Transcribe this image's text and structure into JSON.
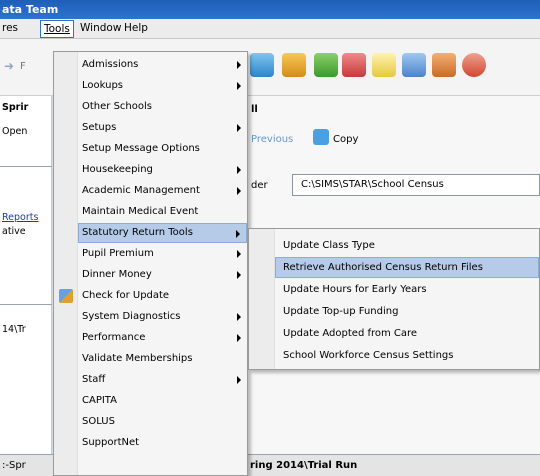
{
  "titlebar": {
    "title": "ata Team"
  },
  "menubar": {
    "items": [
      "res",
      "Tools",
      "Window",
      "Help"
    ]
  },
  "toolbar": {
    "left_fragment": "F"
  },
  "left_panel": {
    "texts": [
      "Sprir",
      "Open",
      "Reports",
      "ative",
      "14\\Tr",
      ":-Spr"
    ]
  },
  "detail": {
    "heading": "ll",
    "previous_label": "Previous",
    "copy_label": "Copy",
    "folder_label": "der",
    "folder_value": "C:\\SIMS\\STAR\\School Census",
    "status_text": "ring 2014\\Trial Run"
  },
  "tools_menu": {
    "items": [
      {
        "label": "Admissions",
        "submenu": true
      },
      {
        "label": "Lookups",
        "submenu": true
      },
      {
        "label": "Other Schools",
        "submenu": false
      },
      {
        "label": "Setups",
        "submenu": true
      },
      {
        "label": "Setup Message Options",
        "submenu": false
      },
      {
        "label": "Housekeeping",
        "submenu": true
      },
      {
        "label": "Academic Management",
        "submenu": true
      },
      {
        "label": "Maintain Medical Event",
        "submenu": false
      },
      {
        "label": "Statutory Return Tools",
        "submenu": true,
        "selected": true
      },
      {
        "label": "Pupil Premium",
        "submenu": true
      },
      {
        "label": "Dinner Money",
        "submenu": true
      },
      {
        "label": "Check for Update",
        "submenu": false
      },
      {
        "label": "System Diagnostics",
        "submenu": true
      },
      {
        "label": "Performance",
        "submenu": true
      },
      {
        "label": "Validate Memberships",
        "submenu": false
      },
      {
        "label": "Staff",
        "submenu": true
      },
      {
        "label": "CAPITA",
        "submenu": false
      },
      {
        "label": "SOLUS",
        "submenu": false
      },
      {
        "label": "SupportNet",
        "submenu": false
      }
    ]
  },
  "statutory_submenu": {
    "items": [
      {
        "label": "Update Class Type"
      },
      {
        "label": "Retrieve Authorised Census Return Files",
        "selected": true
      },
      {
        "label": "Update Hours for Early Years"
      },
      {
        "label": "Update Top-up Funding"
      },
      {
        "label": "Update Adopted from Care"
      },
      {
        "label": "School Workforce Census Settings"
      }
    ]
  }
}
